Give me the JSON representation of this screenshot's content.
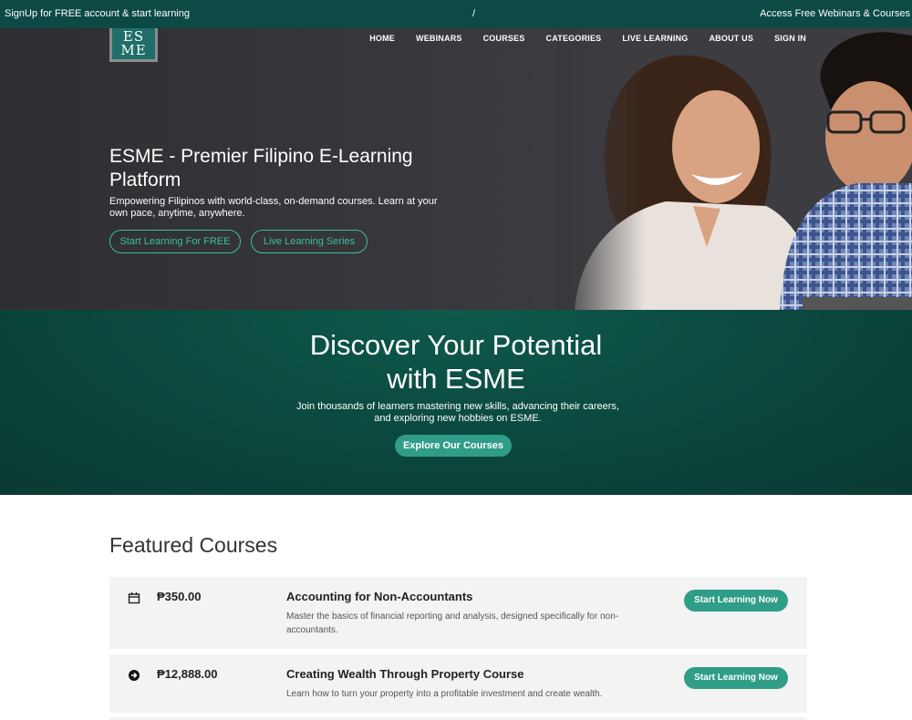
{
  "topbar": {
    "left": "SignUp for FREE account & start learning",
    "middle": "/",
    "right": "Access Free Webinars & Courses"
  },
  "logo": {
    "line1": "ES",
    "line2": "ME"
  },
  "nav": {
    "home": "HOME",
    "webinars": "WEBINARS",
    "courses": "COURSES",
    "categories": "CATEGORIES",
    "live_learning": "LIVE LEARNING",
    "about": "ABOUT US",
    "signin": "SIGN IN"
  },
  "hero": {
    "title": "ESME - Premier Filipino E-Learning Platform",
    "subtitle": "Empowering Filipinos with world-class, on-demand courses. Learn at your own pace, anytime, anywhere.",
    "btn_free": "Start Learning For FREE",
    "btn_live": "Live Learning Series"
  },
  "discover": {
    "title_line1": "Discover Your Potential",
    "title_line2": "with ESME",
    "subtitle": "Join thousands of learners mastering new skills, advancing their careers, and exploring new hobbies on ESME.",
    "button": "Explore Our Courses"
  },
  "featured": {
    "title": "Featured Courses",
    "courses": [
      {
        "icon": "calendar-icon",
        "price": "₱350.00",
        "title": "Accounting for Non-Accountants",
        "description": "Master the basics of financial reporting and analysis, designed specifically for non-accountants.",
        "button": "Start Learning Now"
      },
      {
        "icon": "arrow-circle-icon",
        "price": "₱12,888.00",
        "title": "Creating Wealth Through Property Course",
        "description": "Learn how to turn your property into a profitable investment and create wealth.",
        "button": "Start Learning Now"
      }
    ]
  },
  "colors": {
    "topbar": "#0d4a45",
    "accent": "#2f9d87",
    "outline": "#3bbfa0",
    "hero_bg": "#36363b",
    "discover_bg": "#0b4a40"
  }
}
